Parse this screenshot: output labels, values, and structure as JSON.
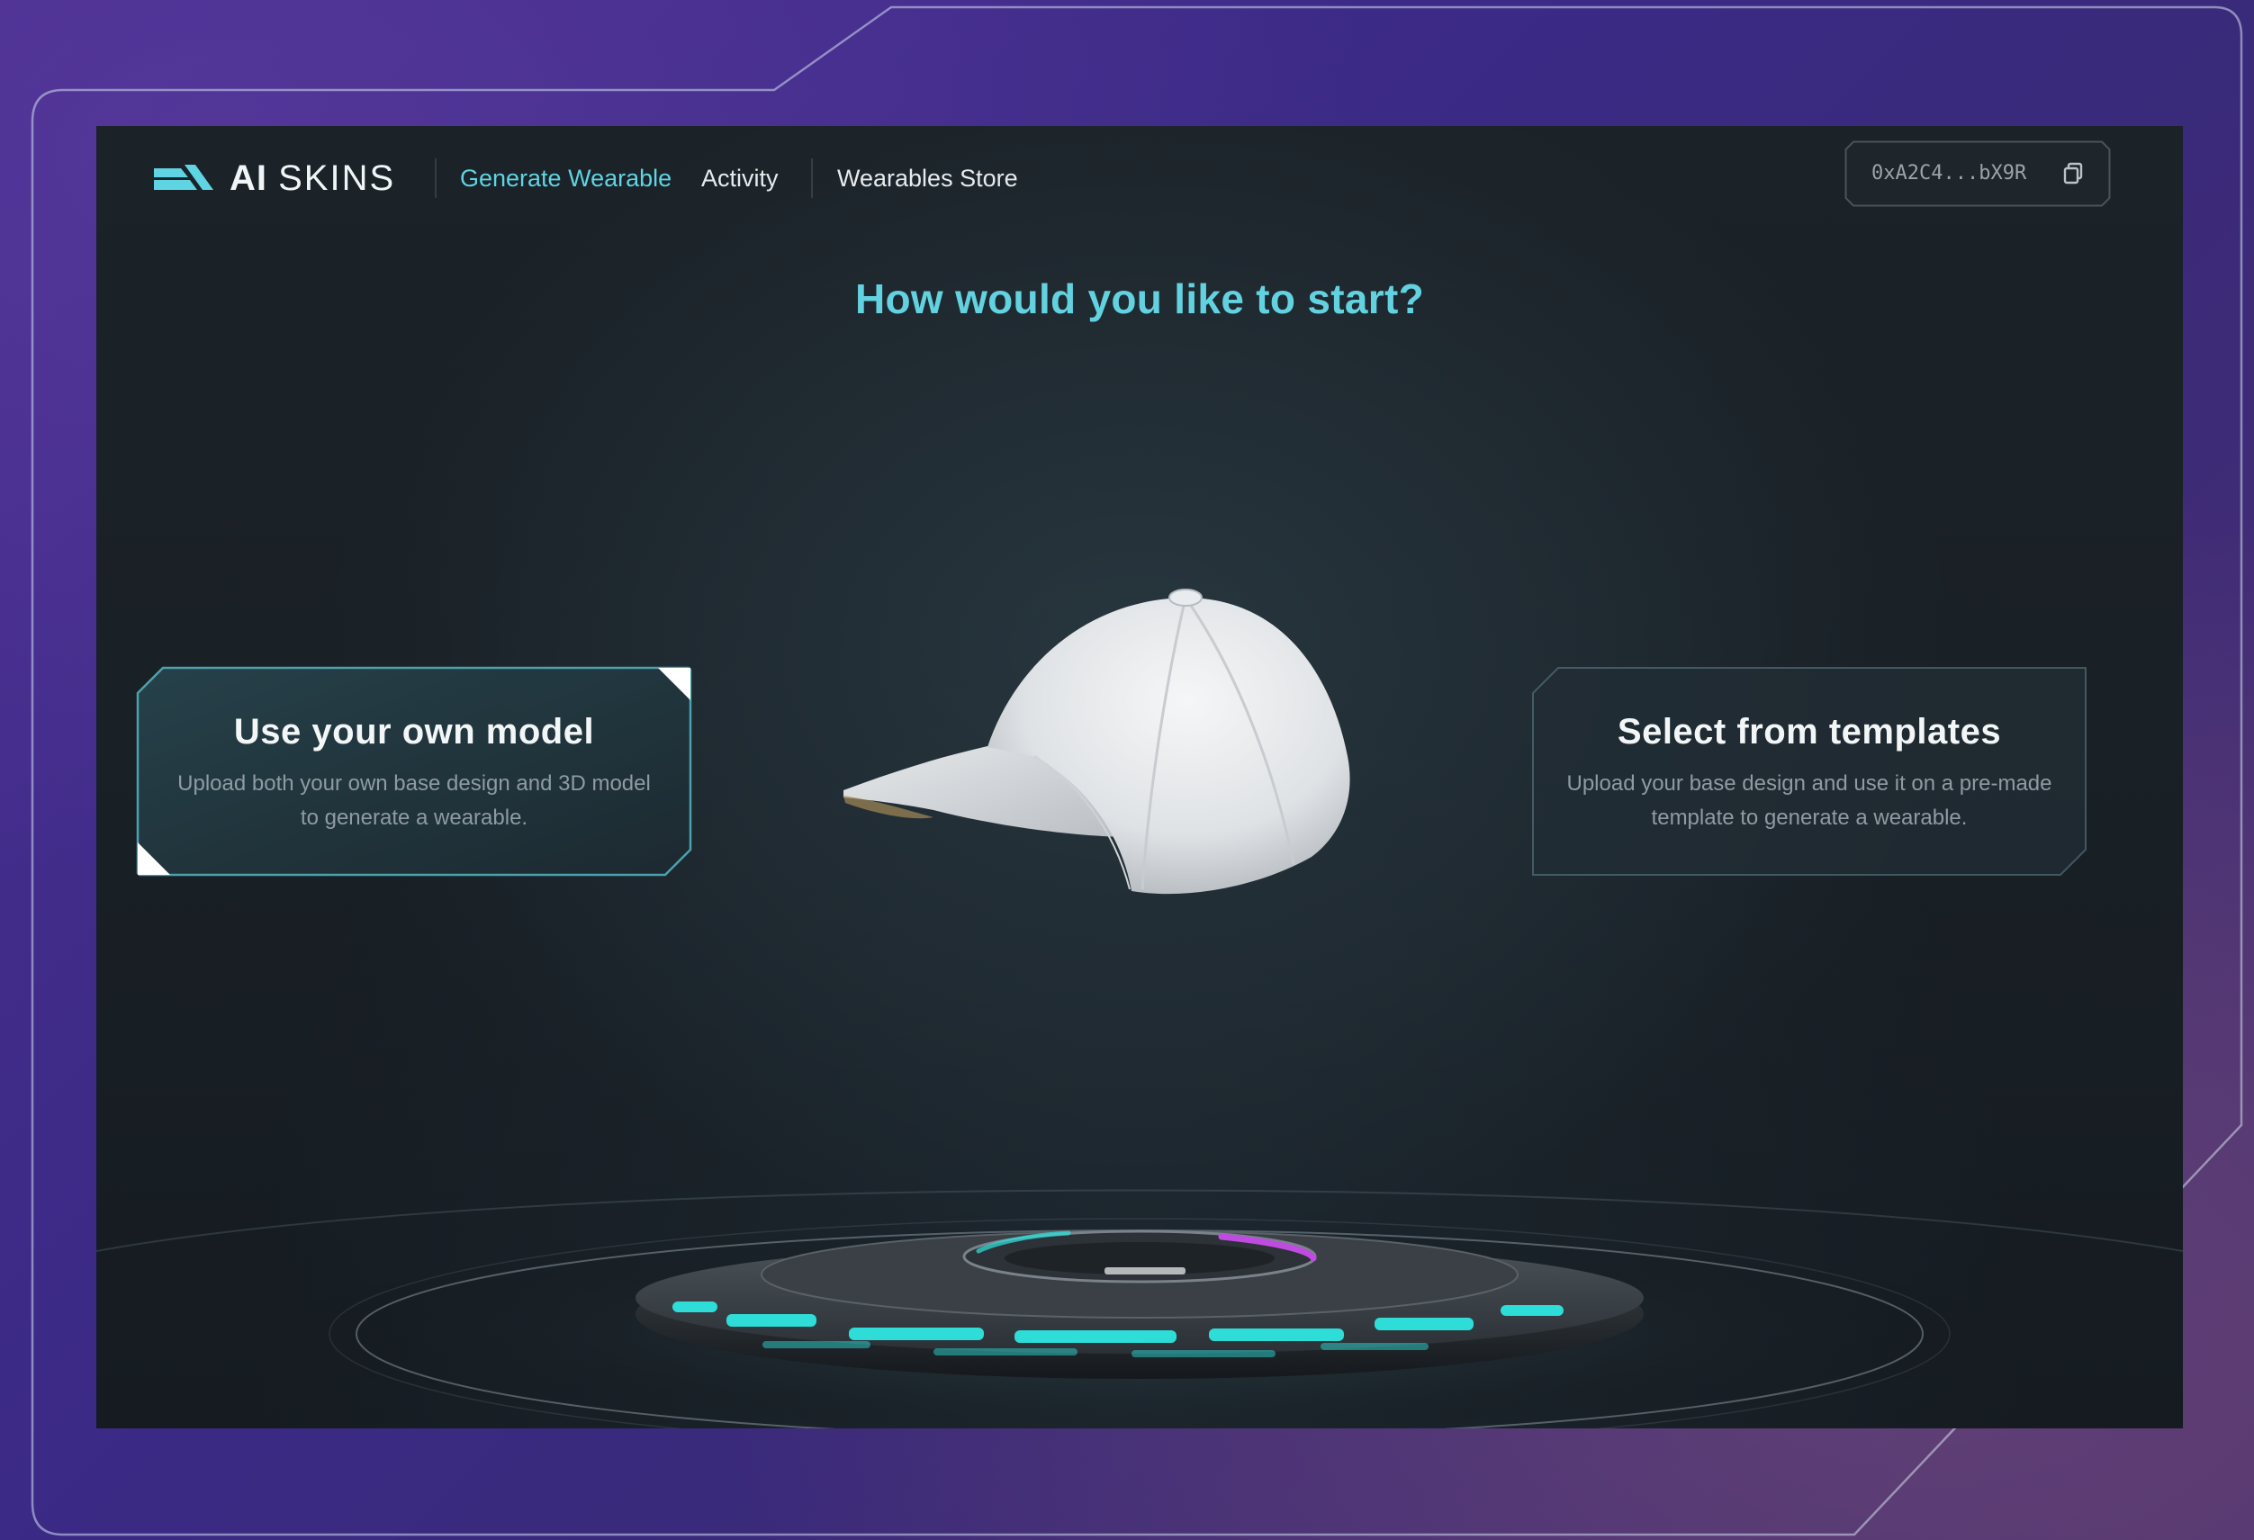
{
  "app": {
    "logo_ai": "AI",
    "logo_skins": "SKINS"
  },
  "nav": {
    "items": [
      {
        "label": "Generate Wearable",
        "active": true
      },
      {
        "label": "Activity",
        "active": false
      },
      {
        "label": "Wearables Store",
        "active": false
      }
    ],
    "wallet_address": "0xA2C4...bX9R",
    "copy_icon": "copy-icon"
  },
  "main": {
    "heading": "How would you like to start?",
    "options": [
      {
        "title": "Use your own model",
        "description": "Upload both your own base design and 3D model to generate a wearable.",
        "selected": true
      },
      {
        "title": "Select from templates",
        "description": "Upload your base design and use it on a pre-made template to generate a wearable.",
        "selected": false
      }
    ],
    "preview_icon": "baseball-cap-icon"
  },
  "colors": {
    "accent": "#5fd4e2",
    "background": "#192026",
    "outer_bg": "#3b2a86",
    "glow": "#2ee6e0",
    "magenta": "#c04be0"
  }
}
